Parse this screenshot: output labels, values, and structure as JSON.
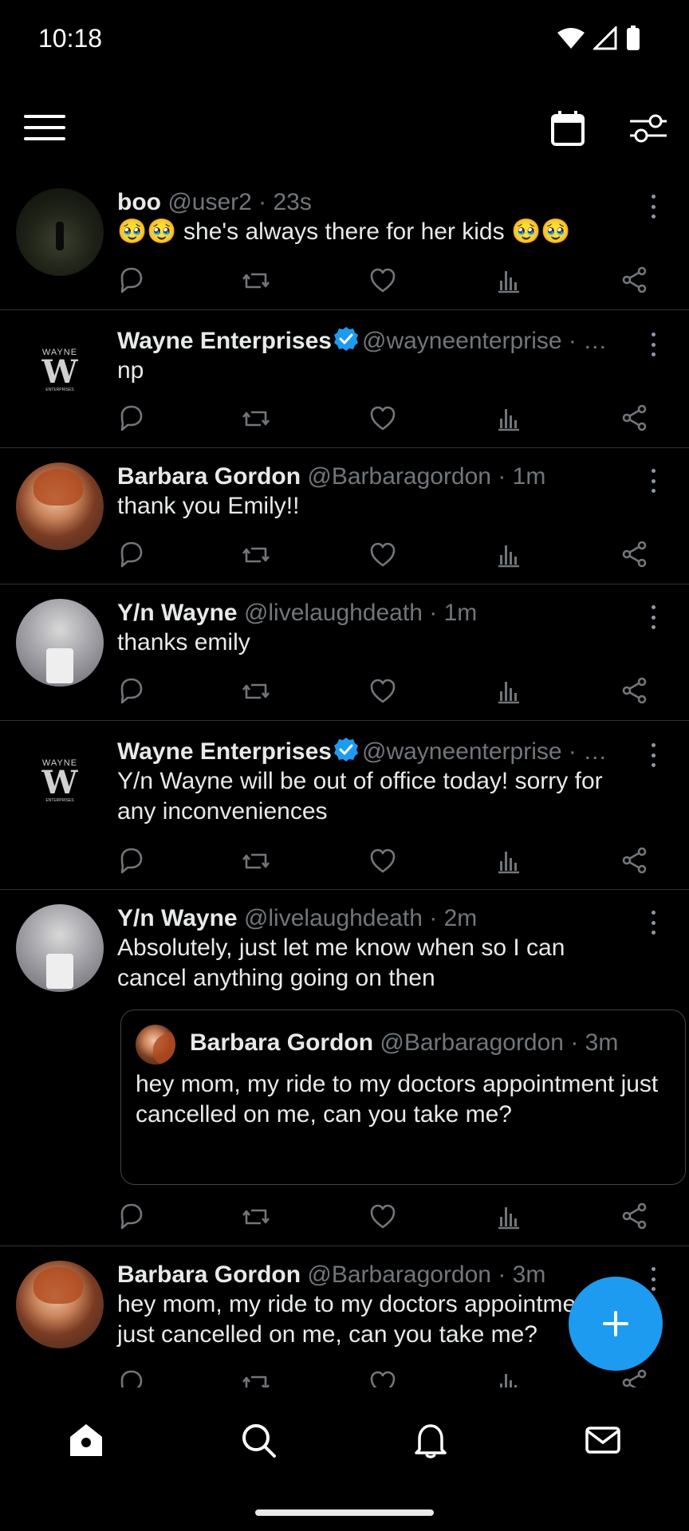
{
  "status_bar": {
    "time": "10:18"
  },
  "colors": {
    "accent": "#1d9bf0",
    "background": "#000000",
    "secondary_text": "#71767b",
    "divider": "#2f3336"
  },
  "top_bar": {
    "icons": [
      "menu-icon",
      "calendar-icon",
      "filter-icon"
    ]
  },
  "tweets": [
    {
      "name": "boo",
      "handle": "@user2",
      "time": "23s",
      "separator": " · ",
      "text": "🥹🥹 she's always there for her kids 🥹🥹",
      "verified": false,
      "avatar": "forest-figure"
    },
    {
      "name": "Wayne Enterprises",
      "handle": "@wayneenterprise",
      "time": "…",
      "separator": " · ",
      "text": "np",
      "verified": true,
      "avatar": "wayne-logo"
    },
    {
      "name": "Barbara Gordon",
      "handle": "@Barbaragordon",
      "time": "1m",
      "separator": " · ",
      "text": "thank you Emily!!",
      "verified": false,
      "avatar": "red-hair-woman"
    },
    {
      "name": "Y/n Wayne",
      "handle": "@livelaughdeath",
      "time": "1m",
      "separator": " · ",
      "text": "thanks emily",
      "verified": false,
      "avatar": "white-cat"
    },
    {
      "name": "Wayne Enterprises",
      "handle": "@wayneenterprise",
      "time": "…",
      "separator": " · ",
      "text": "Y/n Wayne will be out of office today! sorry for any inconveniences",
      "verified": true,
      "avatar": "wayne-logo"
    },
    {
      "name": "Y/n Wayne",
      "handle": "@livelaughdeath",
      "time": "2m",
      "separator": " · ",
      "text": "Absolutely, just let me know when so I can cancel anything going on then",
      "verified": false,
      "avatar": "white-cat",
      "quote": {
        "name": "Barbara Gordon",
        "handle": "@Barbaragordon",
        "time": "3m",
        "separator": " · ",
        "text": "hey mom, my ride to my doctors appointment just cancelled on me, can you take me?"
      }
    },
    {
      "name": "Barbara Gordon",
      "handle": "@Barbaragordon",
      "time": "3m",
      "separator": " · ",
      "text": "hey mom, my ride to my doctors appointment just cancelled on me, can you take me?",
      "verified": false,
      "avatar": "red-hair-woman"
    }
  ],
  "wayne_logo": {
    "top": "WAYNE",
    "letter": "W",
    "bottom": "ENTERPRISES"
  },
  "tweet_actions": [
    "reply-icon",
    "retweet-icon",
    "like-icon",
    "views-icon",
    "share-icon"
  ],
  "fab": {
    "icon": "plus-icon"
  },
  "bottom_nav": {
    "items": [
      "home-icon",
      "search-icon",
      "notifications-icon",
      "messages-icon"
    ]
  }
}
